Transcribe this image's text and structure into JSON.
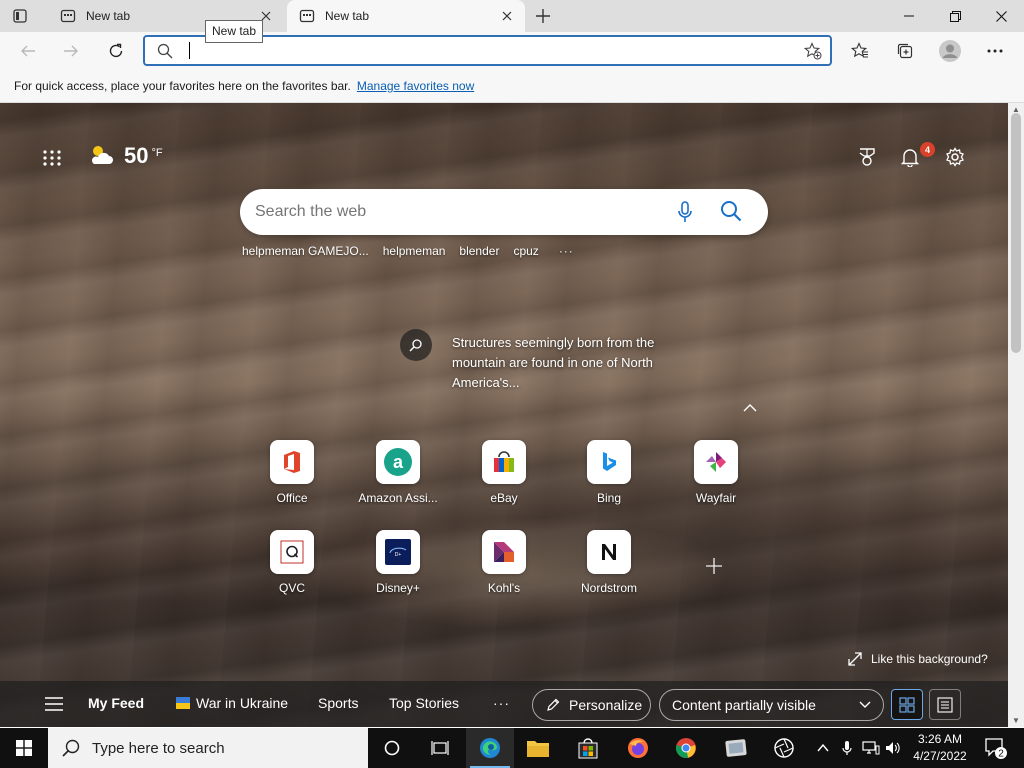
{
  "browser": {
    "tabs": [
      {
        "title": "New tab",
        "active": false
      },
      {
        "title": "New tab",
        "active": true
      }
    ],
    "tooltip": "New tab",
    "address": {
      "value": "",
      "placeholder": ""
    },
    "favorites_bar": {
      "message": "For quick access, place your favorites here on the favorites bar.",
      "link": "Manage favorites now"
    }
  },
  "newtab": {
    "weather": {
      "temp": "50",
      "unit": "°F",
      "icon": "partly-cloudy-icon"
    },
    "notifications_count": "4",
    "search": {
      "placeholder": "Search the web"
    },
    "suggestions": [
      "helpmeman GAMEJO...",
      "helpmeman",
      "blender",
      "cpuz"
    ],
    "suggestions_more": "···",
    "caption": "Structures seemingly born from the mountain are found in one of North America's...",
    "quick_links": [
      {
        "label": "Office"
      },
      {
        "label": "Amazon Assi..."
      },
      {
        "label": "eBay"
      },
      {
        "label": "Bing"
      },
      {
        "label": "Wayfair"
      },
      {
        "label": "QVC"
      },
      {
        "label": "Disney+"
      },
      {
        "label": "Kohl's"
      },
      {
        "label": "Nordstrom"
      }
    ],
    "like_background": "Like this background?",
    "feed": {
      "my_feed": "My Feed",
      "war": "War in Ukraine",
      "sports": "Sports",
      "top_stories": "Top Stories",
      "more": "···",
      "personalize": "Personalize",
      "content_visibility": "Content partially visible"
    }
  },
  "taskbar": {
    "search_placeholder": "Type here to search",
    "time": "3:26 AM",
    "date": "4/27/2022",
    "notifications": "2"
  },
  "colors": {
    "accent": "#2f6fb6",
    "link": "#0a5fb4",
    "badge": "#d9412a"
  }
}
